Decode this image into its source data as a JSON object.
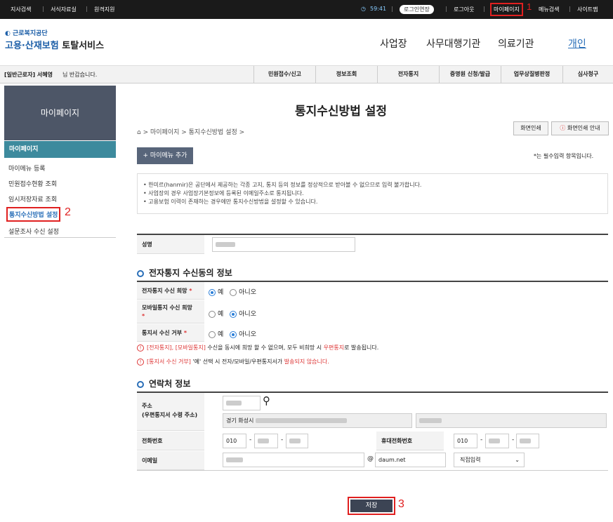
{
  "topbar": {
    "branch": "지사검색",
    "forms": "서식자료실",
    "remote": "원격지원",
    "timer": "59:41",
    "login_ext": "로그인연장",
    "logout": "로그아웃",
    "mypage": "마이페이지",
    "menu_search": "메뉴검색",
    "sitemap": "사이트맵"
  },
  "annotations": {
    "n1": "1",
    "n2": "2",
    "n3": "3"
  },
  "logo": {
    "org": "근로복지공단",
    "service_a": "고용·산재보험",
    "service_b": "토탈서비스"
  },
  "gnb": [
    "사업장",
    "사무대행기관",
    "의료기관",
    "개인"
  ],
  "subnav": {
    "user": "[일반근로자] 서혜영",
    "greet": "님 반갑습니다.",
    "items": [
      "민원접수/신고",
      "정보조회",
      "전자통지",
      "증명원 신청/발급",
      "업무상질병판정",
      "심사청구"
    ]
  },
  "sidebar": {
    "head": "마이페이지",
    "caption": "마이페이지",
    "items": [
      "마이메뉴 등록",
      "민원접수현황 조회",
      "임시저장자료 조회",
      "통지수신방법 설정",
      "설문조사 수신 설정"
    ]
  },
  "page": {
    "title": "통지수신방법 설정",
    "breadcrumb": [
      "마이페이지",
      "통지수신방법 설정"
    ],
    "print": "화면인쇄",
    "print_guide": "화면인쇄 안내",
    "add_menu": "+ 마이메뉴 추가",
    "required": "*는 필수입력 항목입니다."
  },
  "notice": [
    "한미르(hanmir)은 공단에서 제공하는 각종 고지, 통지 등의 정보를 정상적으로 받아볼 수 없으므로 입력 불가합니다.",
    "사업장의 경우 사업장기본정보에 등록된 이메일주소로 통지됩니다.",
    "고용보험 이력이 존재하는 경우에만 통지수신방법을 설정할 수 있습니다."
  ],
  "form": {
    "name_label": "성명",
    "section1": "전자통지 수신동의 정보",
    "e_label": "전자통지 수신 희망",
    "m_label": "모바일통지 수신 희망",
    "r_label": "통지서 수신 거부",
    "yes": "예",
    "no": "아니오",
    "warn1_a": "[전자통지], [모바일통지]",
    "warn1_b": " 수신을 동시에 희망 할 수 없으며, 모두 비희망 시 ",
    "warn1_c": "우편통지",
    "warn1_d": "로 발송됩니다.",
    "warn2_a": "[통지서 수신 거부]",
    "warn2_b": " '예' 선택 시 전자/모바일/우편통지서가 ",
    "warn2_c": "발송되지 않습니다.",
    "section2": "연락처 정보",
    "addr_label": "주소",
    "addr_sub": "(우편통지서 수령 주소)",
    "addr_city": "경기 화성시",
    "phone_label": "전화번호",
    "phone_prefix": "010",
    "mobile_label": "휴대전화번호",
    "mobile_prefix": "010",
    "email_label": "이메일",
    "at": "@",
    "domain": "daum.net",
    "direct": "직접입력"
  },
  "save": "저장"
}
